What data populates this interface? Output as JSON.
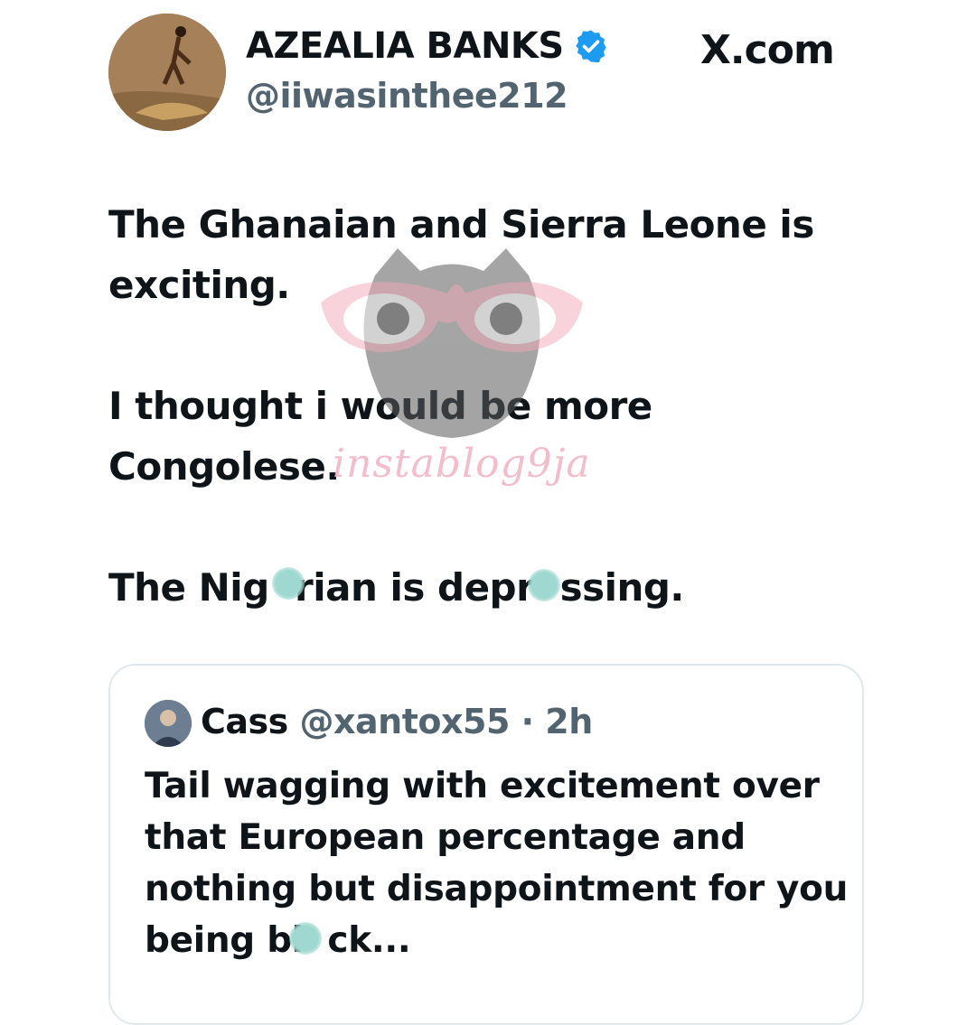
{
  "author": {
    "name": "AZEALIA BANKS",
    "handle": "@iiwasinthee212",
    "verified": true,
    "avatar_icon": "profile-photo"
  },
  "brand": "X.com",
  "tweet": {
    "lines": [
      "The Ghanaian and Sierra Leone is",
      "exciting.",
      "I thought i would be more",
      "Congolese.",
      "The Nig  rian is depr  ssing."
    ]
  },
  "quote": {
    "name": "Cass",
    "handle": "@xantox55",
    "time": "· 2h",
    "text_lines": [
      "Tail wagging with excitement over",
      "that European percentage and",
      "nothing but disappointment for you",
      "being bl  ck..."
    ]
  },
  "watermark": {
    "text": "instablog9ja",
    "logo_icon": "owl-with-glasses"
  },
  "colors": {
    "verified_badge": "#1d9bf0",
    "secondary_text": "#536471",
    "primary_text": "#0f1419",
    "card_border": "#e1e8ed",
    "censor_blob": "#9fd8d0",
    "watermark_pink": "#f2b6c6"
  }
}
